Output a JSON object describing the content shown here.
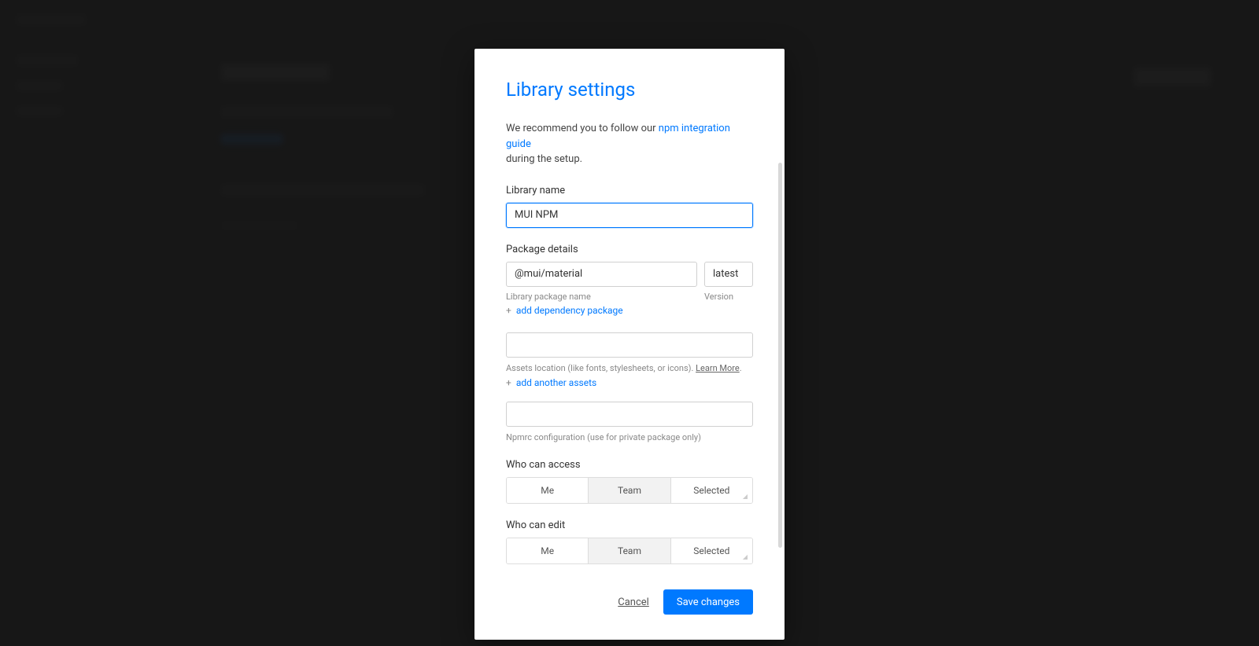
{
  "modal": {
    "title": "Library settings",
    "intro_prefix": "We recommend you to follow our ",
    "intro_link": "npm integration guide",
    "intro_suffix": "during the setup.",
    "library_name": {
      "label": "Library name",
      "value": "MUI NPM"
    },
    "package_details": {
      "label": "Package details",
      "name_value": "@mui/material",
      "version_value": "latest",
      "name_sublabel": "Library package name",
      "version_sublabel": "Version",
      "add_dependency": "add dependency package"
    },
    "assets": {
      "value": "",
      "helper_prefix": "Assets location (like fonts, stylesheets, or icons). ",
      "learn_more": "Learn More",
      "helper_suffix": ".",
      "add_assets": "add another assets"
    },
    "npmrc": {
      "value": "",
      "helper": "Npmrc configuration (use for private package only)"
    },
    "access": {
      "label": "Who can access",
      "options": [
        "Me",
        "Team",
        "Selected"
      ],
      "active_index": 1
    },
    "edit": {
      "label": "Who can edit",
      "options": [
        "Me",
        "Team",
        "Selected"
      ],
      "active_index": 1
    },
    "footer": {
      "cancel": "Cancel",
      "save": "Save changes"
    }
  }
}
